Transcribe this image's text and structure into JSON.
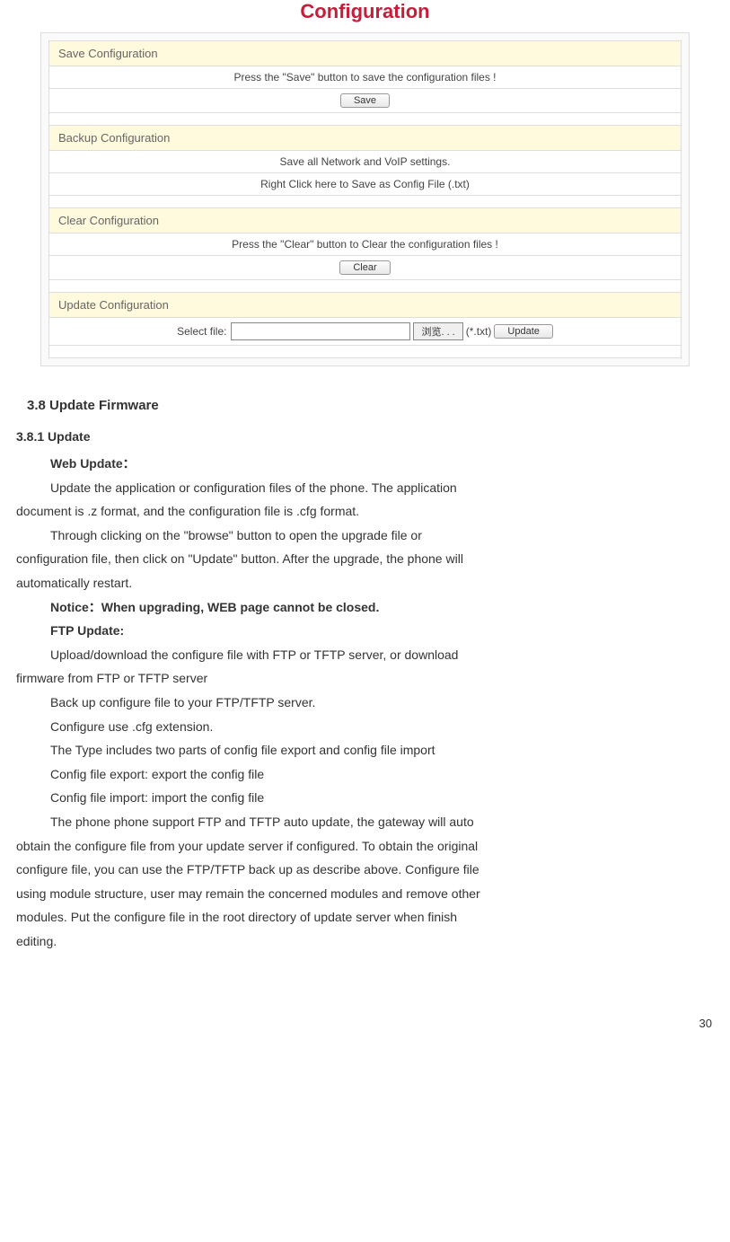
{
  "pageTitle": "Configuration",
  "sections": {
    "save": {
      "header": "Save Configuration",
      "text": "Press the \"Save\" button to save the configuration files !",
      "button": "Save"
    },
    "backup": {
      "header": "Backup Configuration",
      "text1": "Save all Network and VoIP settings.",
      "text2": "Right Click here to Save as Config File (.txt)"
    },
    "clear": {
      "header": "Clear Configuration",
      "text": "Press the \"Clear\" button to Clear the configuration files !",
      "button": "Clear"
    },
    "update": {
      "header": "Update Configuration",
      "label": "Select file:",
      "browse": "浏览. . .",
      "ext": "(*.txt)",
      "button": "Update"
    }
  },
  "doc": {
    "h1": "3.8 Update Firmware",
    "h2": "3.8.1 Update",
    "web_update_label": "Web Update：",
    "p1a": "Update the application or configuration files of the phone. The application",
    "p1b": "document is .z format, and the configuration file is .cfg format.",
    "p2a": "Through clicking on the \"browse\" button to open the upgrade file or",
    "p2b": "configuration file, then click on \"Update\" button. After the upgrade, the phone will",
    "p2c": "automatically restart.",
    "notice": "Notice：When upgrading, WEB page cannot be closed.",
    "ftp_label": "FTP Update:",
    "p3a": "Upload/download the configure file with FTP or TFTP server, or download",
    "p3b": "firmware from FTP or TFTP server",
    "p4": "Back up configure file to your FTP/TFTP server.",
    "p5": "Configure use .cfg extension.",
    "p6": "The Type includes two parts of config file export and config file import",
    "p7": "Config file export: export the config file",
    "p8": "Config file import: import the config file",
    "p9a": "The phone phone support FTP and TFTP auto update, the gateway will auto",
    "p9b": "obtain the configure file from your update server if configured. To obtain the original",
    "p9c": "configure file, you can use the FTP/TFTP back up as describe above. Configure file",
    "p9d": "using module structure, user may remain the concerned modules and remove other",
    "p9e": "modules. Put the configure file in the root directory of update server when finish",
    "p9f": "editing."
  },
  "pageNumber": "30"
}
